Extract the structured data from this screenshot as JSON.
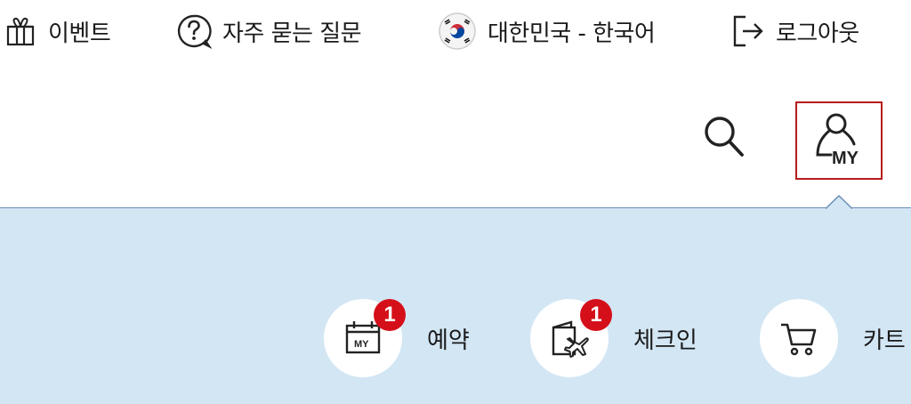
{
  "utility": {
    "event_label": "이벤트",
    "faq_label": "자주 묻는 질문",
    "language_label": "대한민국 - 한국어",
    "logout_label": "로그아웃"
  },
  "header": {
    "my_icon_text": "MY"
  },
  "quick_menu": {
    "reservation": {
      "label": "예약",
      "badge": "1",
      "icon_text": "MY"
    },
    "checkin": {
      "label": "체크인",
      "badge": "1"
    },
    "cart": {
      "label": "카트"
    }
  },
  "colors": {
    "panel_bg": "#d3e6f4",
    "badge": "#d50f1a",
    "focus_border": "#b71c1c"
  },
  "icons": [
    "gift-icon",
    "question-bubble-icon",
    "korea-flag-icon",
    "logout-icon",
    "search-icon",
    "my-page-icon",
    "calendar-my-icon",
    "boarding-pass-plane-icon",
    "cart-icon"
  ]
}
